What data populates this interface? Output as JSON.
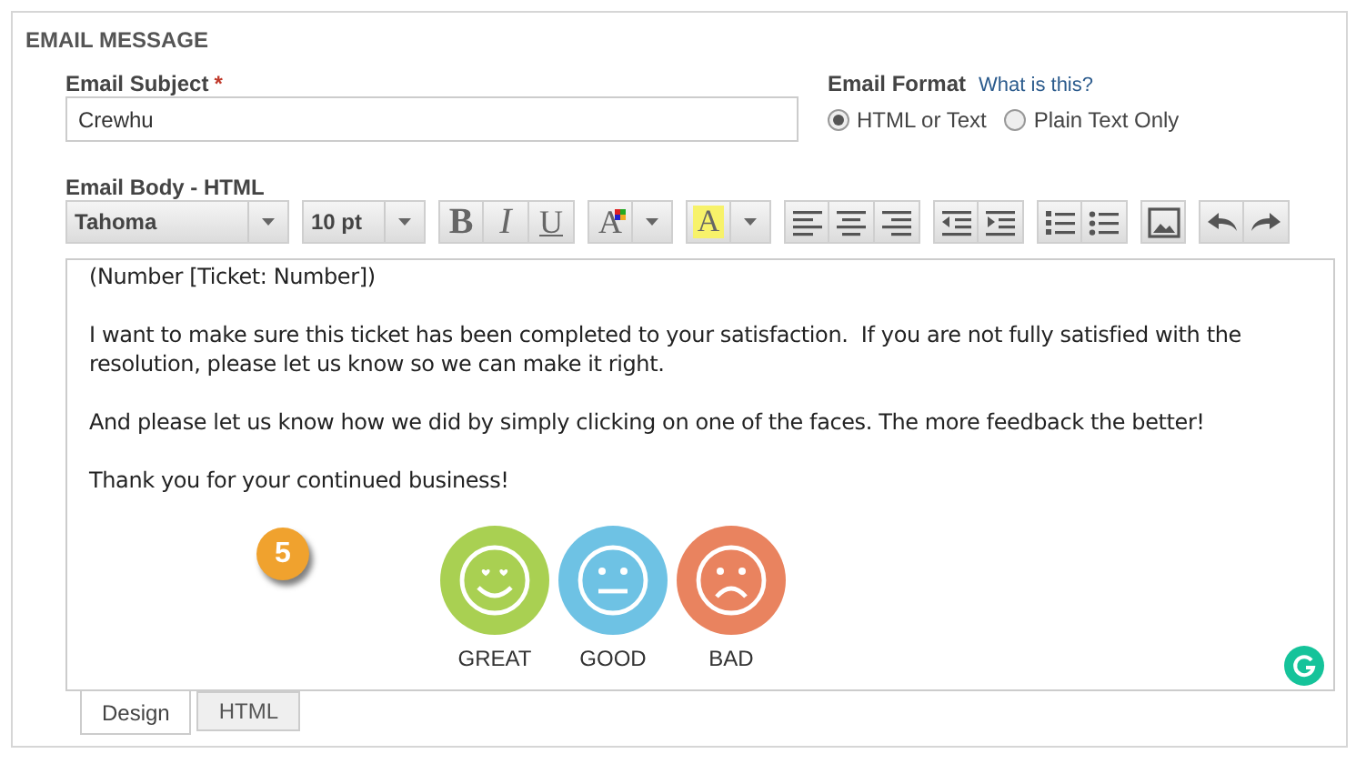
{
  "section_title": "EMAIL MESSAGE",
  "subject": {
    "label": "Email Subject",
    "required": "*",
    "value": "Crewhu"
  },
  "format": {
    "label": "Email Format",
    "help_link": "What is this?",
    "options": [
      {
        "label": "HTML or Text",
        "selected": true
      },
      {
        "label": "Plain Text Only",
        "selected": false
      }
    ]
  },
  "body_label": "Email Body - HTML",
  "toolbar": {
    "font": "Tahoma",
    "size": "10 pt",
    "groups": [
      [
        {
          "kind": "bold",
          "glyph": "B"
        },
        {
          "kind": "italic",
          "glyph": "I"
        },
        {
          "kind": "underline",
          "glyph": "U"
        }
      ],
      [
        {
          "kind": "font-color",
          "glyph": "A"
        },
        {
          "kind": "dropdown"
        }
      ],
      [
        {
          "kind": "highlight",
          "glyph": "A"
        },
        {
          "kind": "dropdown"
        }
      ],
      [
        {
          "kind": "align-left"
        },
        {
          "kind": "align-center"
        },
        {
          "kind": "align-right"
        }
      ],
      [
        {
          "kind": "outdent"
        },
        {
          "kind": "indent"
        }
      ],
      [
        {
          "kind": "numbered-list"
        },
        {
          "kind": "bullet-list"
        }
      ],
      [
        {
          "kind": "image"
        }
      ],
      [
        {
          "kind": "undo"
        },
        {
          "kind": "redo"
        }
      ]
    ]
  },
  "paragraphs": [
    "(Number [Ticket: Number])",
    "I want to make sure this ticket has been completed to your satisfaction.  If you are not fully satisfied with the resolution, please let us know so we can make it right.",
    "And please let us know how we did by simply clicking on one of the faces. The more feedback the better!",
    "Thank you for your continued business!"
  ],
  "step_badge": "5",
  "faces": [
    {
      "kind": "great",
      "label": "GREAT",
      "color": "#a9d052"
    },
    {
      "kind": "good",
      "label": "GOOD",
      "color": "#6ec2e4"
    },
    {
      "kind": "bad",
      "label": "BAD",
      "color": "#e9835f"
    }
  ],
  "tabs": [
    {
      "label": "Design",
      "selected": true
    },
    {
      "label": "HTML",
      "selected": false
    }
  ]
}
